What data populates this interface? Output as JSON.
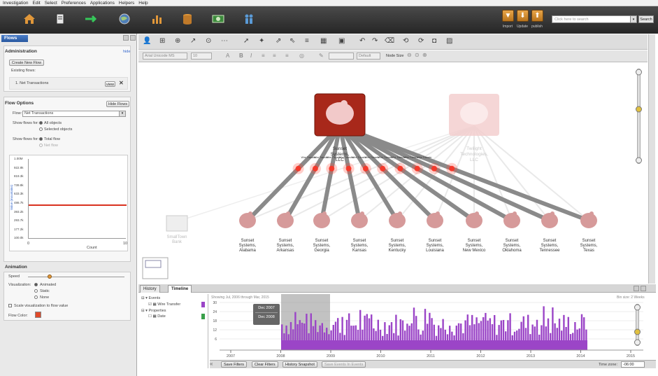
{
  "menu": [
    "Investigation",
    "Edit",
    "Select",
    "Preferences",
    "Applications",
    "Helpers",
    "Help"
  ],
  "topbar": {
    "icons": [
      "home-icon",
      "notebook-icon",
      "flows-icon",
      "globe-icon",
      "chart-icon",
      "database-icon",
      "money-icon",
      "people-icon"
    ],
    "right_buttons": [
      {
        "label": "Import",
        "icon": "import-icon"
      },
      {
        "label": "Update",
        "icon": "update-icon"
      },
      {
        "label": "publish",
        "icon": "publish-icon"
      }
    ],
    "search_placeholder": "Click here to search",
    "search_button": "Search"
  },
  "left": {
    "tab": "Flows",
    "admin": {
      "title": "Administration",
      "hide": "hide",
      "create_button": "Create New Flow",
      "existing_label": "Existing flows:",
      "flow_item": "1. Net Transactions",
      "view_button": "view"
    },
    "options": {
      "title": "Flow Options",
      "hide_button": "Hide Flows",
      "flow_label": "Flow:",
      "flow_value": "Net Transactions",
      "show_for_label": "Show flows for:",
      "all_objects": "All objects",
      "selected_objects": "Selected objects",
      "show_for_label2": "Show flows for:",
      "total_flow": "Total flow",
      "net_flow": "Net flow"
    },
    "histogram": {
      "y_ticks": [
        "1.00M",
        "922.9k",
        "819.3k",
        "739.8k",
        "633.3k",
        "486.7k",
        "393.2k",
        "293.7k",
        "177.2k",
        "100.0k"
      ],
      "y_label": "Value (mountains)",
      "x_min": "0",
      "x_label": "Count",
      "x_max": "10"
    },
    "animation": {
      "title": "Animation",
      "speed_label": "Speed",
      "viz_label": "Visualization:",
      "animated": "Animated",
      "static": "Static",
      "none": "None",
      "scale_checkbox": "Scale visualization to flow value",
      "flow_color": "Flow Color:",
      "flow_color_value": "#e04a2a"
    }
  },
  "graph": {
    "toolbar2": {
      "font": "Arial Unicode MS",
      "size": "10",
      "default": "Default",
      "node_size": "Node Size"
    },
    "hub1": {
      "label": "Sunset Systems, LLC"
    },
    "hub2": {
      "label": "Twilight Technologies, LLC"
    },
    "orphan": {
      "label": "SmallTown Bank"
    },
    "edge_labels": [
      "Wire Transfer",
      "Wire Transfer",
      "Wire Transfer",
      "Wire Transfer",
      "Wire Transfer",
      "Wire Transfer",
      "Wire Transfer",
      "Wire Transfer",
      "Wire Transfer",
      "Wire Transfer"
    ],
    "nodes": [
      {
        "label": "Sunset Systems, Alabama"
      },
      {
        "label": "Sunset Systems, Arkansas"
      },
      {
        "label": "Sunset Systems, Georgia"
      },
      {
        "label": "Sunset Systems, Kansas"
      },
      {
        "label": "Sunset Systems, Kentucky"
      },
      {
        "label": "Sunset Systems, Louisiana"
      },
      {
        "label": "Sunset Systems, New Mexico"
      },
      {
        "label": "Sunset Systems, Oklahoma"
      },
      {
        "label": "Sunset Systems, Tennessee"
      },
      {
        "label": "Sunset Systems, Texas"
      }
    ]
  },
  "bottom": {
    "tabs": [
      "History",
      "Timeline"
    ],
    "tree": {
      "events": "Events",
      "wire_transfer": "Wire Transfer",
      "properties": "Properties",
      "date": "Date"
    },
    "timeline": {
      "showing": "Showing Jul, 2006 through Mar, 2015",
      "bin": "Bin size: 2 Weeks",
      "y_ticks": [
        "30",
        "24",
        "18",
        "12",
        "6"
      ],
      "years": [
        "2007",
        "2008",
        "2009",
        "2010",
        "2011",
        "2012",
        "2013",
        "2014",
        "2015"
      ],
      "tooltip1": "Dec 2007",
      "tooltip2": "Dec 2008"
    },
    "buttons": [
      "Save Filters",
      "Clear Filters",
      "History Snapshot",
      "Save Events In Events"
    ],
    "timezone_label": "Time zone:",
    "timezone_value": "-06:00"
  }
}
